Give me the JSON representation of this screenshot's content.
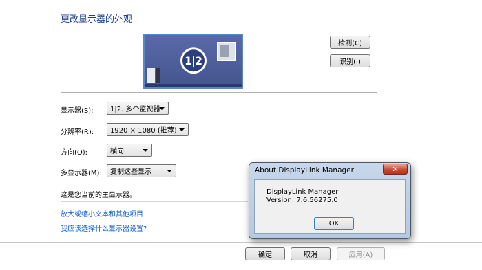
{
  "page": {
    "title": "更改显示器的外观",
    "detect_button": "检测(C)",
    "identify_button": "识别(I)",
    "monitor_badge": "1|2"
  },
  "settings": {
    "display_label": "显示器(S):",
    "display_value": "1|2. 多个监视器",
    "resolution_label": "分辨率(R):",
    "resolution_value": "1920 × 1080 (推荐)",
    "orientation_label": "方向(O):",
    "orientation_value": "横向",
    "multi_display_label": "多显示器(M):",
    "multi_display_value": "复制这些显示",
    "main_display_note": "这是您当前的主显示器。"
  },
  "links": {
    "text_size": "放大或缩小文本和其他项目",
    "which_settings": "我应该选择什么显示器设置?"
  },
  "footer": {
    "ok_button": "确定",
    "cancel_button": "取消",
    "apply_button": "应用(A)"
  },
  "dialog": {
    "title": "About DisplayLink Manager",
    "close_glyph": "✕",
    "product_name": "DisplayLink Manager",
    "version": "Version: 7.6.56275.0",
    "ok_button": "OK"
  }
}
